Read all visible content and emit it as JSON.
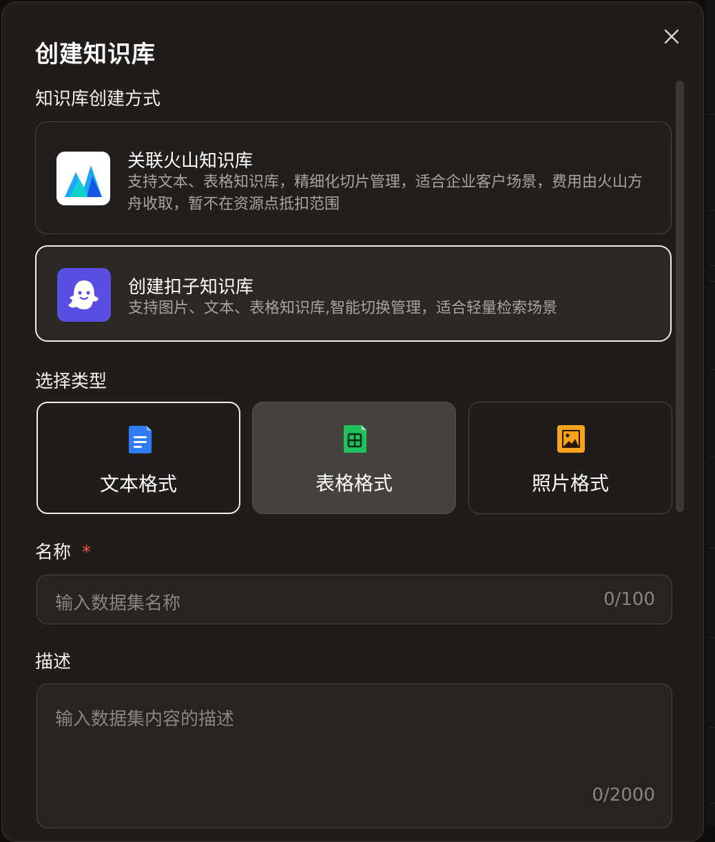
{
  "dialog": {
    "title": "创建知识库"
  },
  "creation_method": {
    "label": "知识库创建方式",
    "options": [
      {
        "title": "关联火山知识库",
        "description": "支持文本、表格知识库，精细化切片管理，适合企业客户场景，费用由火山方舟收取，暂不在资源点抵扣范围",
        "icon": "volcano-mountain-icon",
        "selected": false
      },
      {
        "title": "创建扣子知识库",
        "description": "支持图片、文本、表格知识库,智能切换管理，适合轻量检索场景",
        "icon": "coze-ghost-icon",
        "selected": true
      }
    ]
  },
  "type_select": {
    "label": "选择类型",
    "options": [
      {
        "label": "文本格式",
        "icon": "document-icon",
        "color": "#2f7cf6",
        "selected": true
      },
      {
        "label": "表格格式",
        "icon": "table-icon",
        "color": "#1fc15c",
        "selected": false
      },
      {
        "label": "照片格式",
        "icon": "image-icon",
        "color": "#f9a21b",
        "selected": false
      }
    ]
  },
  "name_field": {
    "label": "名称",
    "required_mark": "*",
    "placeholder": "输入数据集名称",
    "counter": "0/100"
  },
  "description_field": {
    "label": "描述",
    "placeholder": "输入数据集内容的描述",
    "counter": "0/2000"
  },
  "colors": {
    "required": "#f5514a",
    "accent_document": "#2f7cf6",
    "accent_table": "#1fc15c",
    "accent_image": "#f9a21b",
    "coze_brand": "#5a4fe0"
  }
}
